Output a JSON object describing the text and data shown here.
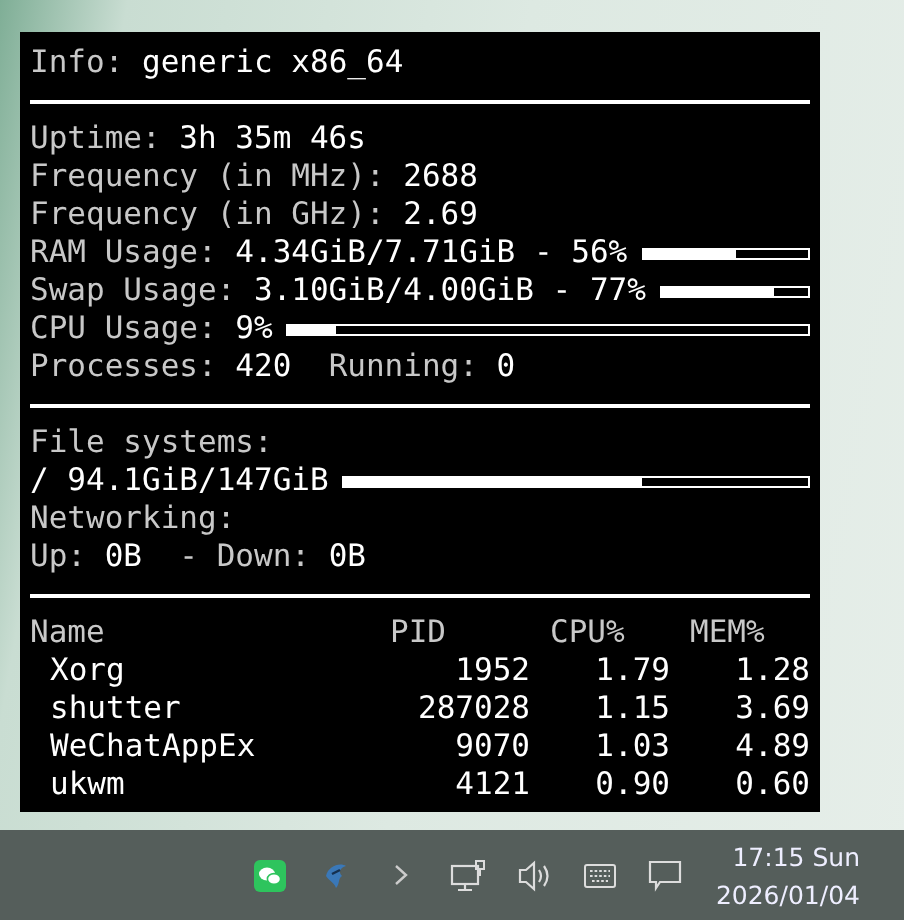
{
  "conky": {
    "info": {
      "label": "Info:",
      "value": "generic x86_64"
    },
    "stats": [
      {
        "kind": "text",
        "fields": [
          {
            "label": "Uptime:",
            "value": "3h 35m 46s"
          }
        ]
      },
      {
        "kind": "text",
        "fields": [
          {
            "label": "Frequency (in MHz):",
            "value": "2688"
          }
        ]
      },
      {
        "kind": "text",
        "fields": [
          {
            "label": "Frequency (in GHz):",
            "value": "2.69"
          }
        ]
      },
      {
        "kind": "meter",
        "fields": [
          {
            "label": "RAM Usage:",
            "value": "4.34GiB/7.71GiB - 56%"
          }
        ],
        "level": 0.56
      },
      {
        "kind": "meter",
        "fields": [
          {
            "label": "Swap Usage:",
            "value": "3.10GiB/4.00GiB - 77%"
          }
        ],
        "level": 0.77
      },
      {
        "kind": "meter",
        "fields": [
          {
            "label": "CPU Usage:",
            "value": "9%"
          }
        ],
        "level": 0.09
      },
      {
        "kind": "text",
        "fields": [
          {
            "label": "Processes:",
            "value": "420"
          },
          {
            "label": "Running:",
            "value": "0"
          }
        ]
      }
    ],
    "file_systems": {
      "label": "File systems:",
      "mounts": [
        {
          "mount": "/",
          "value": "94.1GiB/147GiB",
          "level": 0.64
        }
      ]
    },
    "networking": {
      "label": "Networking:",
      "fields": [
        {
          "label": "Up:",
          "value": "0B"
        },
        {
          "label": "- Down:",
          "value": "0B"
        }
      ]
    },
    "processes": {
      "columns": [
        "Name",
        "PID",
        "CPU%",
        "MEM%"
      ],
      "rows": [
        [
          "Xorg",
          "1952",
          "1.79",
          "1.28"
        ],
        [
          "shutter",
          "287028",
          "1.15",
          "3.69"
        ],
        [
          "WeChatAppEx",
          "9070",
          "1.03",
          "4.89"
        ],
        [
          "ukwm",
          "4121",
          "0.90",
          "0.60"
        ]
      ]
    }
  },
  "taskbar": {
    "time": "17:15 Sun",
    "date": "2026/01/04"
  }
}
